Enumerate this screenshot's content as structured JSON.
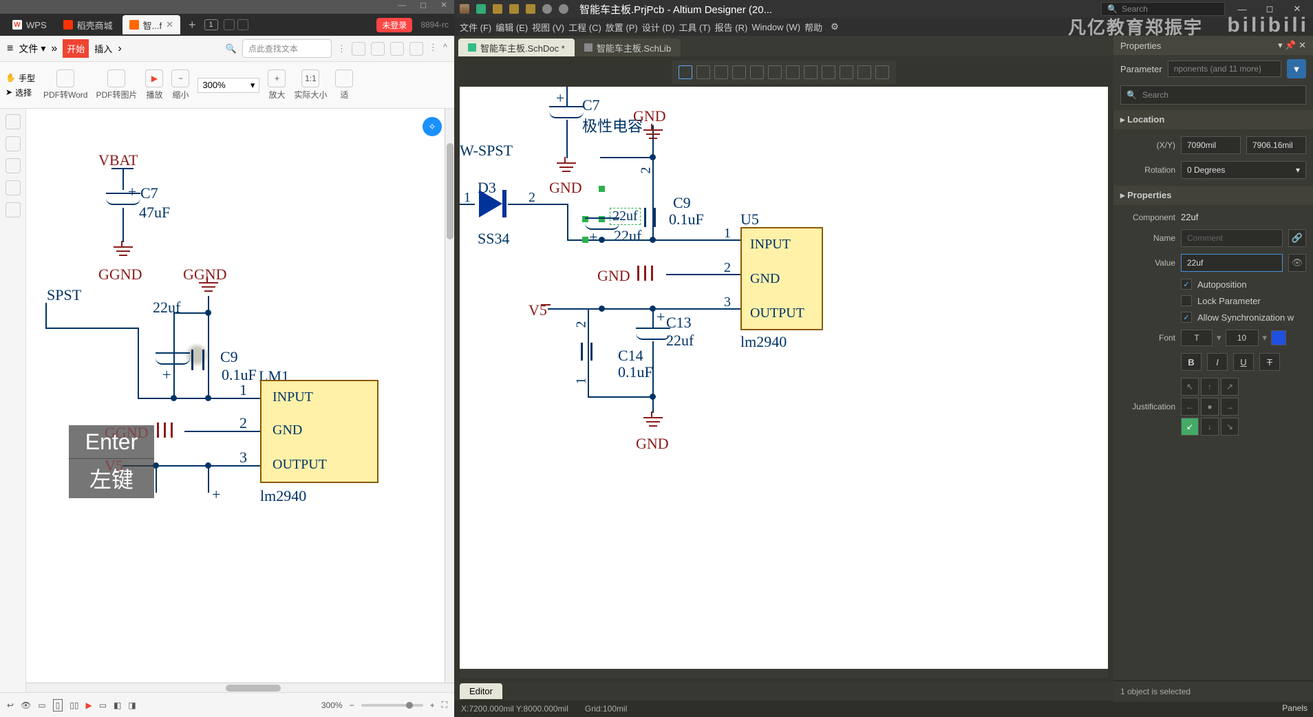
{
  "wps": {
    "app": "WPS",
    "tabs": {
      "daoke": "稻壳商城",
      "pdf": "智...f",
      "new": "+",
      "count_badge": "1"
    },
    "login_badge": "未登录",
    "right_badge": "8894-rc",
    "ribbon": {
      "menu": "文件",
      "start": "开始",
      "insert": "插入",
      "search_placeholder": "点此查找文本",
      "chevron": "▾"
    },
    "tools": {
      "handtool": "手型",
      "select": "选择",
      "pdf2word": "PDF转Word",
      "pdf2pic": "PDF转图片",
      "play": "播放",
      "zoomout": "缩小",
      "zoom": "300%",
      "zoomin": "放大",
      "actual": "实际大小",
      "fit": "适"
    },
    "schematic": {
      "vbat": "VBAT",
      "c7": "C7",
      "c7val": "47uF",
      "ggnd1": "GGND",
      "ggnd2": "GGND",
      "spst": "SPST",
      "c_sel": "22uf",
      "c9": "C9",
      "c9val": "0.1uF",
      "lm1": "LM1",
      "ic_input": "INPUT",
      "ic_gnd": "GND",
      "ic_output": "OUTPUT",
      "lm2940": "lm2940",
      "pin1": "1",
      "pin2": "2",
      "pin3": "3",
      "overlay_enter": "Enter",
      "overlay_left": "左键",
      "overlay_ggnd": "GGND",
      "overlay_v5": "V5"
    },
    "status": {
      "zoom": "300%"
    }
  },
  "ad": {
    "title": "智能车主板.PrjPcb - Altium Designer (20...",
    "search_placeholder": "Search",
    "menus": [
      "文件 (F)",
      "编辑 (E)",
      "视图 (V)",
      "工程 (C)",
      "放置 (P)",
      "设计 (D)",
      "工具 (T)",
      "报告 (R)",
      "Window (W)",
      "帮助"
    ],
    "watermark1": "凡亿教育郑振宇",
    "watermark2": "bilibili",
    "doctabs": {
      "schdoc": "智能车主板.SchDoc *",
      "schlib": "智能车主板.SchLib"
    },
    "schematic": {
      "c7": "C7",
      "c7note": "极性电容",
      "gnd": "GND",
      "wspst": "W-SPST",
      "d3": "D3",
      "ss34": "SS34",
      "pin1": "1",
      "pin2": "2",
      "pin3": "3",
      "c_sel": "22uf",
      "c_sel2": "22uf",
      "c9": "C9",
      "c9val": "0.1uF",
      "u5": "U5",
      "ic_input": "INPUT",
      "ic_gnd": "GND",
      "ic_output": "OUTPUT",
      "lm2940": "lm2940",
      "v5": "V5",
      "c13": "C13",
      "c13val": "22uf",
      "c14": "C14",
      "c14val": "0.1uF"
    },
    "editor_tab": "Editor",
    "status": {
      "coords": "X:7200.000mil Y:8000.000mil",
      "grid": "Grid:100mil"
    },
    "props": {
      "title": "Properties",
      "filter_left": "Parameter",
      "filter_right": "nponents (and 11 more)",
      "search_placeholder": "Search",
      "sec_location": "Location",
      "xy_label": "(X/Y)",
      "xy_x": "7090mil",
      "xy_y": "7906.16mil",
      "rotation_label": "Rotation",
      "rotation_val": "0 Degrees",
      "sec_props": "Properties",
      "component_label": "Component",
      "component_val": "22uf",
      "name_label": "Name",
      "name_placeholder": "Comment",
      "value_label": "Value",
      "value_val": "22uf",
      "autoposition": "Autoposition",
      "lockparam": "Lock Parameter",
      "allowsync": "Allow Synchronization w",
      "font_label": "Font",
      "font_name": "T",
      "font_size": "10",
      "bold": "B",
      "italic": "I",
      "underline": "U",
      "strike": "T",
      "justification": "Justification",
      "footer": "1 object is selected",
      "panels": "Panels"
    }
  }
}
